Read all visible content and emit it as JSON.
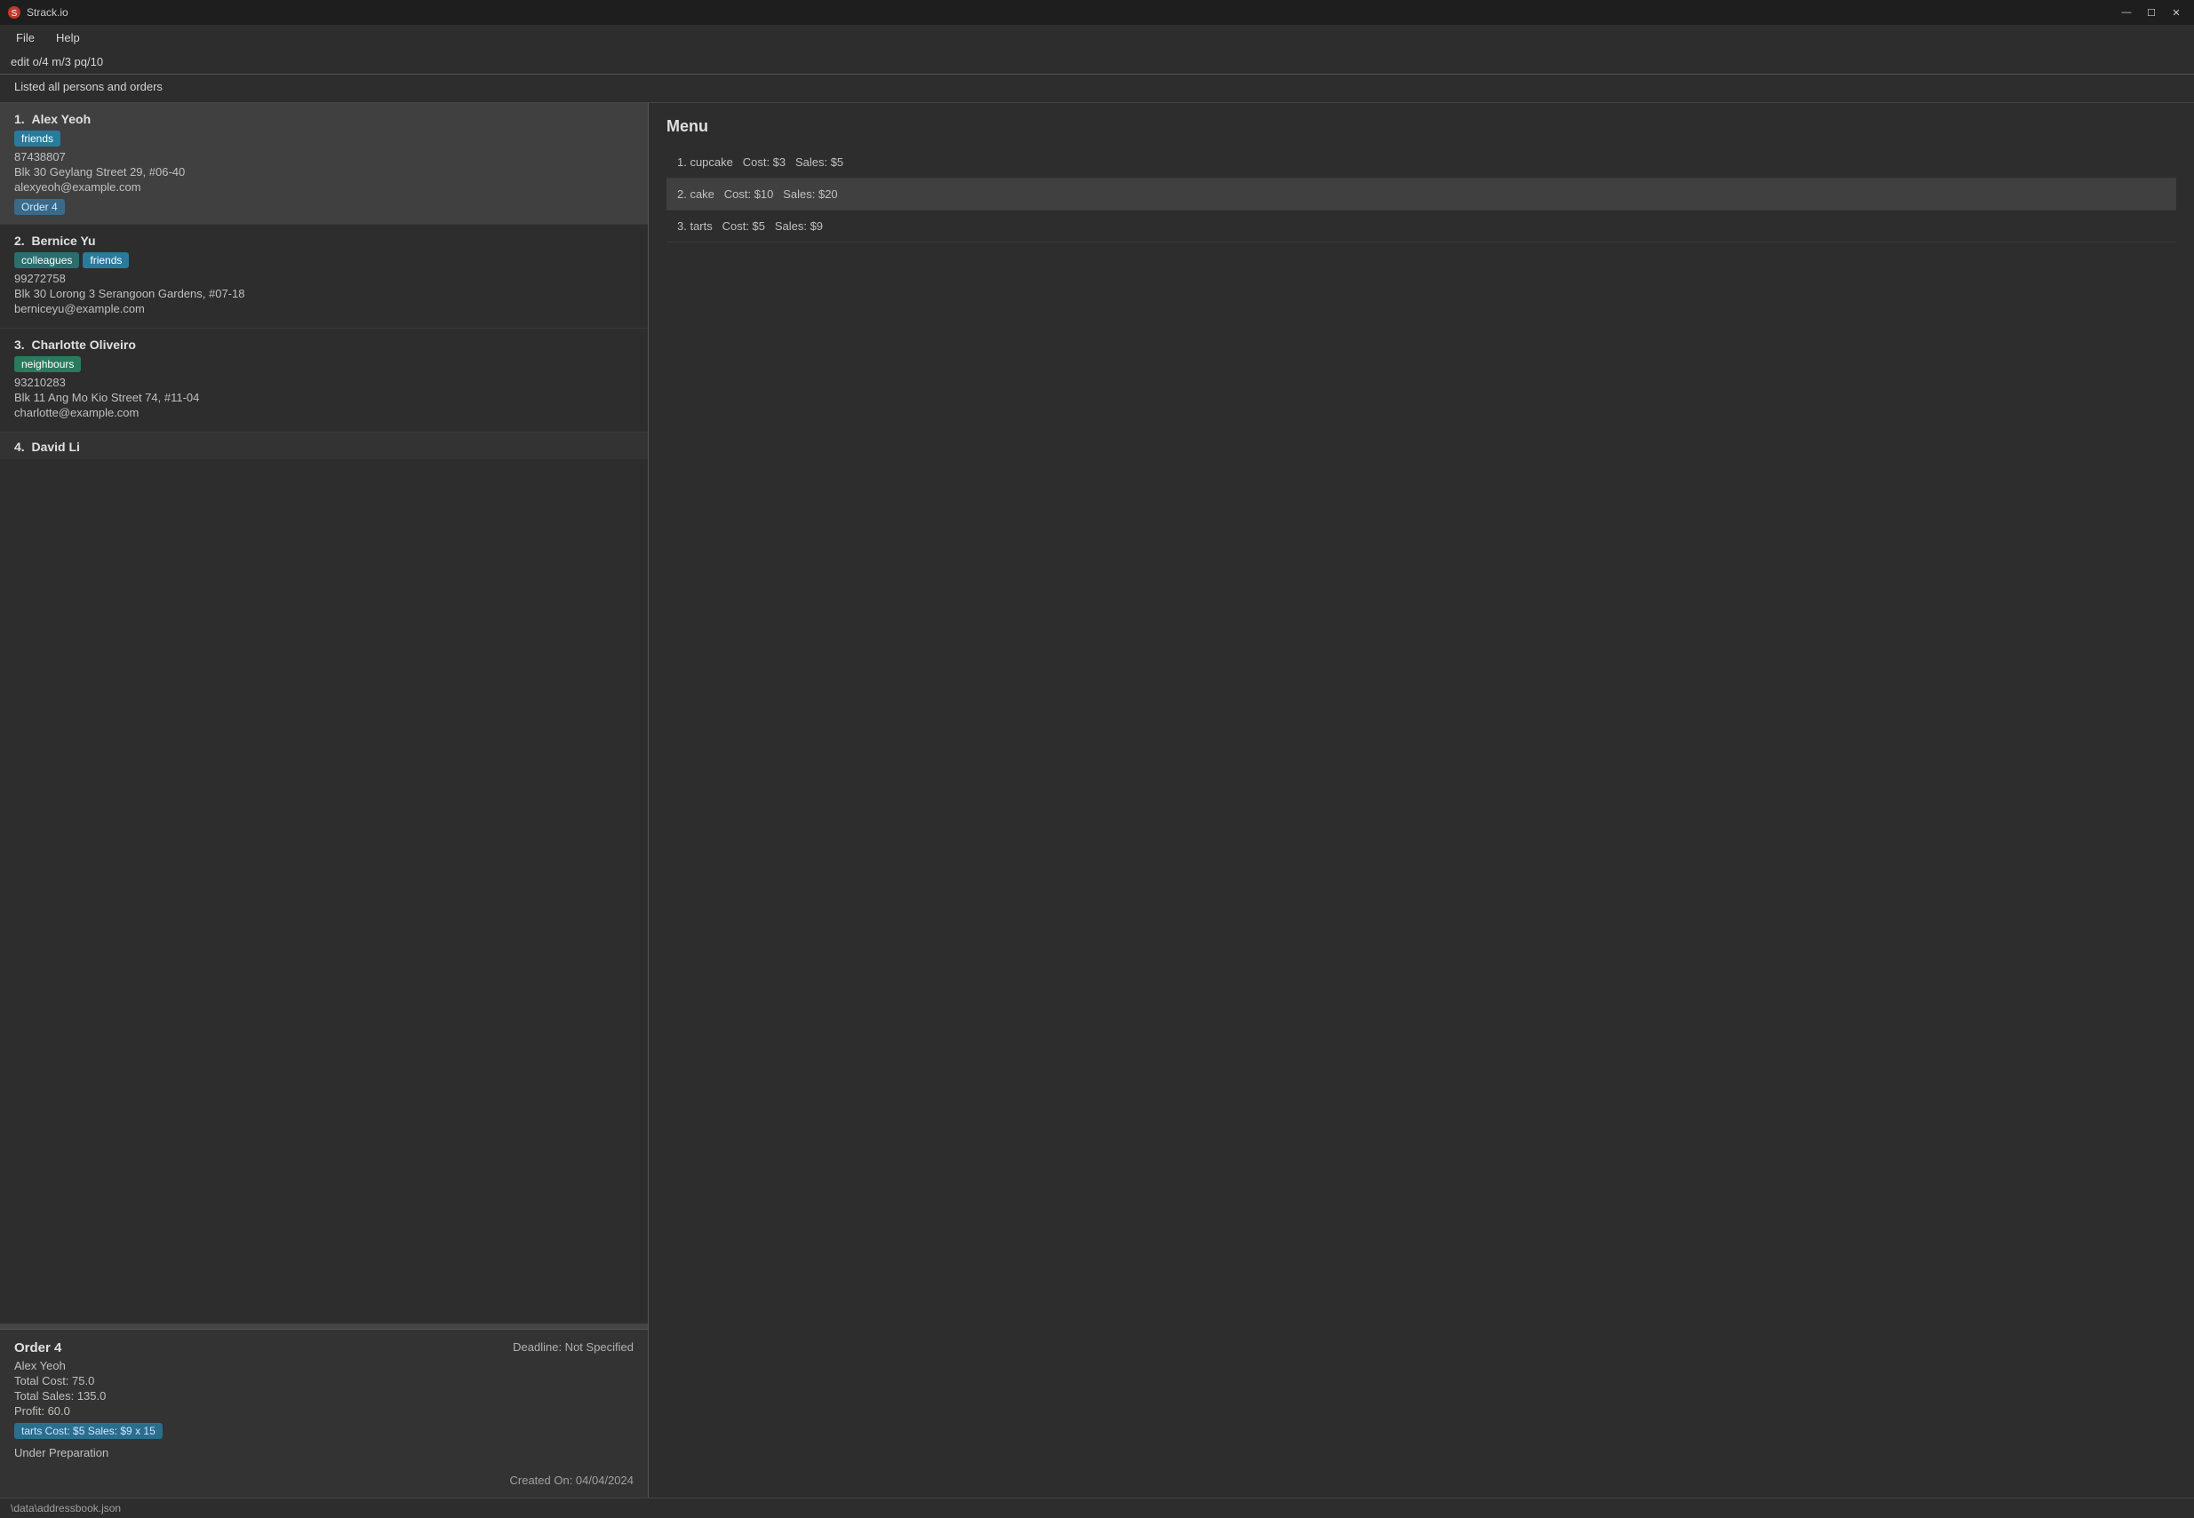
{
  "titleBar": {
    "appName": "Strack.io",
    "minimizeLabel": "—",
    "maximizeLabel": "☐",
    "closeLabel": "✕"
  },
  "menuBar": {
    "items": [
      {
        "label": "File"
      },
      {
        "label": "Help"
      }
    ]
  },
  "toolbar": {
    "text": "edit o/4 m/3 pq/10"
  },
  "statusMessage": "Listed all persons and orders",
  "persons": [
    {
      "number": "1.",
      "name": "Alex Yeoh",
      "tags": [
        "friends"
      ],
      "phone": "87438807",
      "address": "Blk 30 Geylang Street 29, #06-40",
      "email": "alexyeoh@example.com",
      "order": "Order 4",
      "selected": true
    },
    {
      "number": "2.",
      "name": "Bernice Yu",
      "tags": [
        "colleagues",
        "friends"
      ],
      "phone": "99272758",
      "address": "Blk 30 Lorong 3 Serangoon Gardens, #07-18",
      "email": "berniceyu@example.com",
      "order": null,
      "selected": false
    },
    {
      "number": "3.",
      "name": "Charlotte Oliveiro",
      "tags": [
        "neighbours"
      ],
      "phone": "93210283",
      "address": "Blk 11 Ang Mo Kio Street 74, #11-04",
      "email": "charlotte@example.com",
      "order": null,
      "selected": false
    },
    {
      "number": "4.",
      "name": "David Li",
      "tags": [],
      "phone": "",
      "address": "",
      "email": "",
      "order": null,
      "selected": false,
      "partial": true
    }
  ],
  "orderDetail": {
    "title": "Order 4",
    "deadline": "Deadline: Not Specified",
    "customer": "Alex Yeoh",
    "totalCost": "Total Cost: 75.0",
    "totalSales": "Total Sales: 135.0",
    "profit": "Profit: 60.0",
    "itemTag": "tarts Cost: $5 Sales: $9 x 15",
    "status": "Under Preparation",
    "createdOn": "Created On: 04/04/2024"
  },
  "menu": {
    "title": "Menu",
    "items": [
      {
        "label": "1. cupcake  Cost: $3  Sales: $5",
        "selected": false
      },
      {
        "label": "2. cake  Cost: $10  Sales: $20",
        "selected": true
      },
      {
        "label": "3. tarts  Cost: $5  Sales: $9",
        "selected": false
      }
    ]
  },
  "bottomBar": {
    "path": "\\data\\addressbook.json"
  },
  "tagColors": {
    "friends": "tag-friends",
    "colleagues": "tag-colleagues",
    "neighbours": "tag-neighbours"
  }
}
